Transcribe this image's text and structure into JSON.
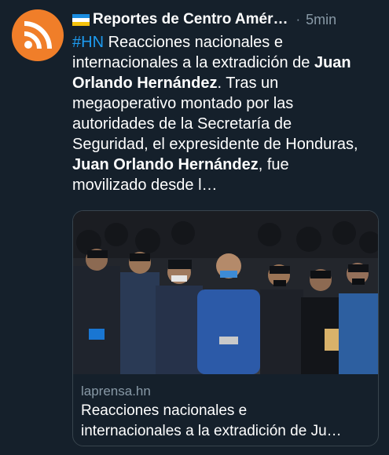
{
  "colors": {
    "background": "#15202b",
    "link": "#1d9bf0",
    "secondary_text": "#8899a6",
    "avatar_bg": "#f07e29"
  },
  "tweet": {
    "avatar_icon": "rss-feed-icon",
    "flag_icon": "honduras-flag-icon",
    "account_name": "Reportes de Centro Amér…",
    "separator": "·",
    "time": "5min",
    "hashtag": "#HN",
    "text_lines": [
      [
        {
          "t": "#HN",
          "s": "tag"
        },
        {
          "t": " Reacciones nacionales e"
        }
      ],
      [
        {
          "t": "internacionales a la extradición de "
        },
        {
          "t": "Juan",
          "s": "b"
        }
      ],
      [
        {
          "t": "Orlando Hernández",
          "s": "b"
        },
        {
          "t": ". Tras un"
        }
      ],
      [
        {
          "t": "megaoperativo montado por las"
        }
      ],
      [
        {
          "t": "autoridades de la Secretaría de"
        }
      ],
      [
        {
          "t": "Seguridad, el expresidente de Honduras,"
        }
      ],
      [
        {
          "t": "Juan Orlando Hernández",
          "s": "b"
        },
        {
          "t": ", fue"
        }
      ],
      [
        {
          "t": "movilizado desde l…"
        }
      ]
    ]
  },
  "card": {
    "image_description": "news-photo",
    "domain": "laprensa.hn",
    "title_line1": "Reacciones nacionales e",
    "title_line2": "internacionales a la extradición de Ju…"
  }
}
